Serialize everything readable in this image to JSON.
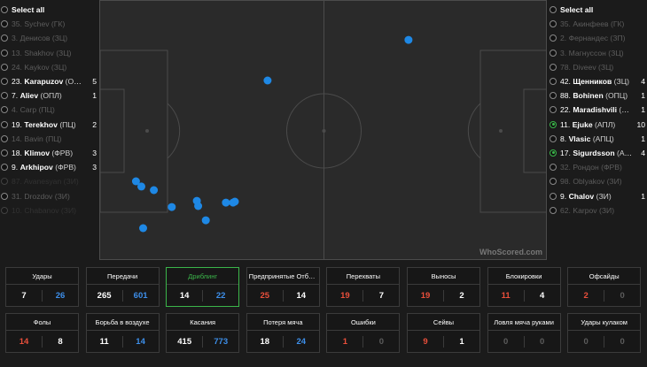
{
  "left_players": {
    "select_all": "Select all",
    "items": [
      {
        "num": "35.",
        "name": "Sychev",
        "pos": "(ГК)",
        "count": "",
        "state": "dim"
      },
      {
        "num": "3.",
        "name": "Денисов",
        "pos": "(ЗЦ)",
        "count": "",
        "state": "dim"
      },
      {
        "num": "13.",
        "name": "Shakhov",
        "pos": "(ЗЦ)",
        "count": "",
        "state": "dim"
      },
      {
        "num": "24.",
        "name": "Kaykov",
        "pos": "(ЗЦ)",
        "count": "",
        "state": "dim"
      },
      {
        "num": "23.",
        "name": "Karapuzov",
        "pos": "(ОПЛ)",
        "count": "5",
        "state": "active"
      },
      {
        "num": "7.",
        "name": "Aliev",
        "pos": "(ОПЛ)",
        "count": "1",
        "state": "active"
      },
      {
        "num": "4.",
        "name": "Carp",
        "pos": "(ПЦ)",
        "count": "",
        "state": "dim"
      },
      {
        "num": "19.",
        "name": "Terekhov",
        "pos": "(ПЦ)",
        "count": "2",
        "state": "active"
      },
      {
        "num": "14.",
        "name": "Bavin",
        "pos": "(ПЦ)",
        "count": "",
        "state": "dim"
      },
      {
        "num": "18.",
        "name": "Klimov",
        "pos": "(ФРВ)",
        "count": "3",
        "state": "active"
      },
      {
        "num": "9.",
        "name": "Arkhipov",
        "pos": "(ФРВ)",
        "count": "3",
        "state": "active"
      },
      {
        "num": "87.",
        "name": "Avanesyan",
        "pos": "(ЗИ)",
        "count": "",
        "state": "faded"
      },
      {
        "num": "31.",
        "name": "Drozdov",
        "pos": "(ЗИ)",
        "count": "",
        "state": "dim"
      },
      {
        "num": "10.",
        "name": "Chabanov",
        "pos": "(ЗИ)",
        "count": "",
        "state": "faded"
      }
    ]
  },
  "right_players": {
    "select_all": "Select all",
    "items": [
      {
        "num": "35.",
        "name": "Акинфеев",
        "pos": "(ГК)",
        "count": "",
        "state": "dim"
      },
      {
        "num": "2.",
        "name": "Фернандес",
        "pos": "(ЗП)",
        "count": "",
        "state": "dim"
      },
      {
        "num": "3.",
        "name": "Магнуссон",
        "pos": "(ЗЦ)",
        "count": "",
        "state": "dim"
      },
      {
        "num": "78.",
        "name": "Diveev",
        "pos": "(ЗЦ)",
        "count": "",
        "state": "dim"
      },
      {
        "num": "42.",
        "name": "Щенников",
        "pos": "(ЗЦ)",
        "count": "4",
        "state": "active"
      },
      {
        "num": "88.",
        "name": "Bohinen",
        "pos": "(ОПЦ)",
        "count": "1",
        "state": "active"
      },
      {
        "num": "22.",
        "name": "Maradishvili",
        "pos": "(ОПЦ)",
        "count": "1",
        "state": "active"
      },
      {
        "num": "11.",
        "name": "Ejuke",
        "pos": "(АПЛ)",
        "count": "10",
        "state": "active",
        "on": true
      },
      {
        "num": "8.",
        "name": "Vlasic",
        "pos": "(АПЦ)",
        "count": "1",
        "state": "active"
      },
      {
        "num": "17.",
        "name": "Sigurdsson",
        "pos": "(АП...",
        "count": "4",
        "state": "active",
        "on": true
      },
      {
        "num": "32.",
        "name": "Рондон",
        "pos": "(ФРВ)",
        "count": "",
        "state": "dim"
      },
      {
        "num": "98.",
        "name": "Oblyakov",
        "pos": "(ЗИ)",
        "count": "",
        "state": "dim"
      },
      {
        "num": "9.",
        "name": "Chalov",
        "pos": "(ЗИ)",
        "count": "1",
        "state": "active"
      },
      {
        "num": "62.",
        "name": "Karpov",
        "pos": "(ЗИ)",
        "count": "",
        "state": "dim"
      }
    ]
  },
  "pitch": {
    "watermark": "WhoScored.com",
    "dot_color": "#1e88e5",
    "events": [
      {
        "x": 68.9,
        "y": 15.0
      },
      {
        "x": 37.4,
        "y": 30.6
      },
      {
        "x": 8.0,
        "y": 69.4
      },
      {
        "x": 9.2,
        "y": 71.4
      },
      {
        "x": 12.0,
        "y": 72.8
      },
      {
        "x": 16.0,
        "y": 79.3
      },
      {
        "x": 21.6,
        "y": 76.9
      },
      {
        "x": 21.9,
        "y": 78.9
      },
      {
        "x": 28.1,
        "y": 77.6
      },
      {
        "x": 29.7,
        "y": 77.6
      },
      {
        "x": 30.1,
        "y": 77.2
      },
      {
        "x": 23.6,
        "y": 84.4
      },
      {
        "x": 9.6,
        "y": 87.4
      }
    ]
  },
  "stats": [
    {
      "label": "Удары",
      "home": "7",
      "away": "26",
      "home_color": "white",
      "away_color": "blue"
    },
    {
      "label": "Передачи",
      "home": "265",
      "away": "601",
      "home_color": "white",
      "away_color": "blue"
    },
    {
      "label": "Дриблинг",
      "home": "14",
      "away": "22",
      "home_color": "white",
      "away_color": "blue",
      "highlight": true
    },
    {
      "label": "Предпринятые Отбо...",
      "home": "25",
      "away": "14",
      "home_color": "red",
      "away_color": "white"
    },
    {
      "label": "Перехваты",
      "home": "19",
      "away": "7",
      "home_color": "red",
      "away_color": "white"
    },
    {
      "label": "Выносы",
      "home": "19",
      "away": "2",
      "home_color": "red",
      "away_color": "white"
    },
    {
      "label": "Блокировки",
      "home": "11",
      "away": "4",
      "home_color": "red",
      "away_color": "white"
    },
    {
      "label": "Офсайды",
      "home": "2",
      "away": "0",
      "home_color": "red",
      "away_color": "grey"
    },
    {
      "label": "Фолы",
      "home": "14",
      "away": "8",
      "home_color": "red",
      "away_color": "white"
    },
    {
      "label": "Борьба в воздухе",
      "home": "11",
      "away": "14",
      "home_color": "white",
      "away_color": "blue"
    },
    {
      "label": "Касания",
      "home": "415",
      "away": "773",
      "home_color": "white",
      "away_color": "blue"
    },
    {
      "label": "Потеря мяча",
      "home": "18",
      "away": "24",
      "home_color": "white",
      "away_color": "blue"
    },
    {
      "label": "Ошибки",
      "home": "1",
      "away": "0",
      "home_color": "red",
      "away_color": "grey"
    },
    {
      "label": "Сейвы",
      "home": "9",
      "away": "1",
      "home_color": "red",
      "away_color": "white"
    },
    {
      "label": "Ловля мяча руками",
      "home": "0",
      "away": "0",
      "home_color": "grey",
      "away_color": "grey"
    },
    {
      "label": "Удары кулаком",
      "home": "0",
      "away": "0",
      "home_color": "grey",
      "away_color": "grey"
    }
  ]
}
